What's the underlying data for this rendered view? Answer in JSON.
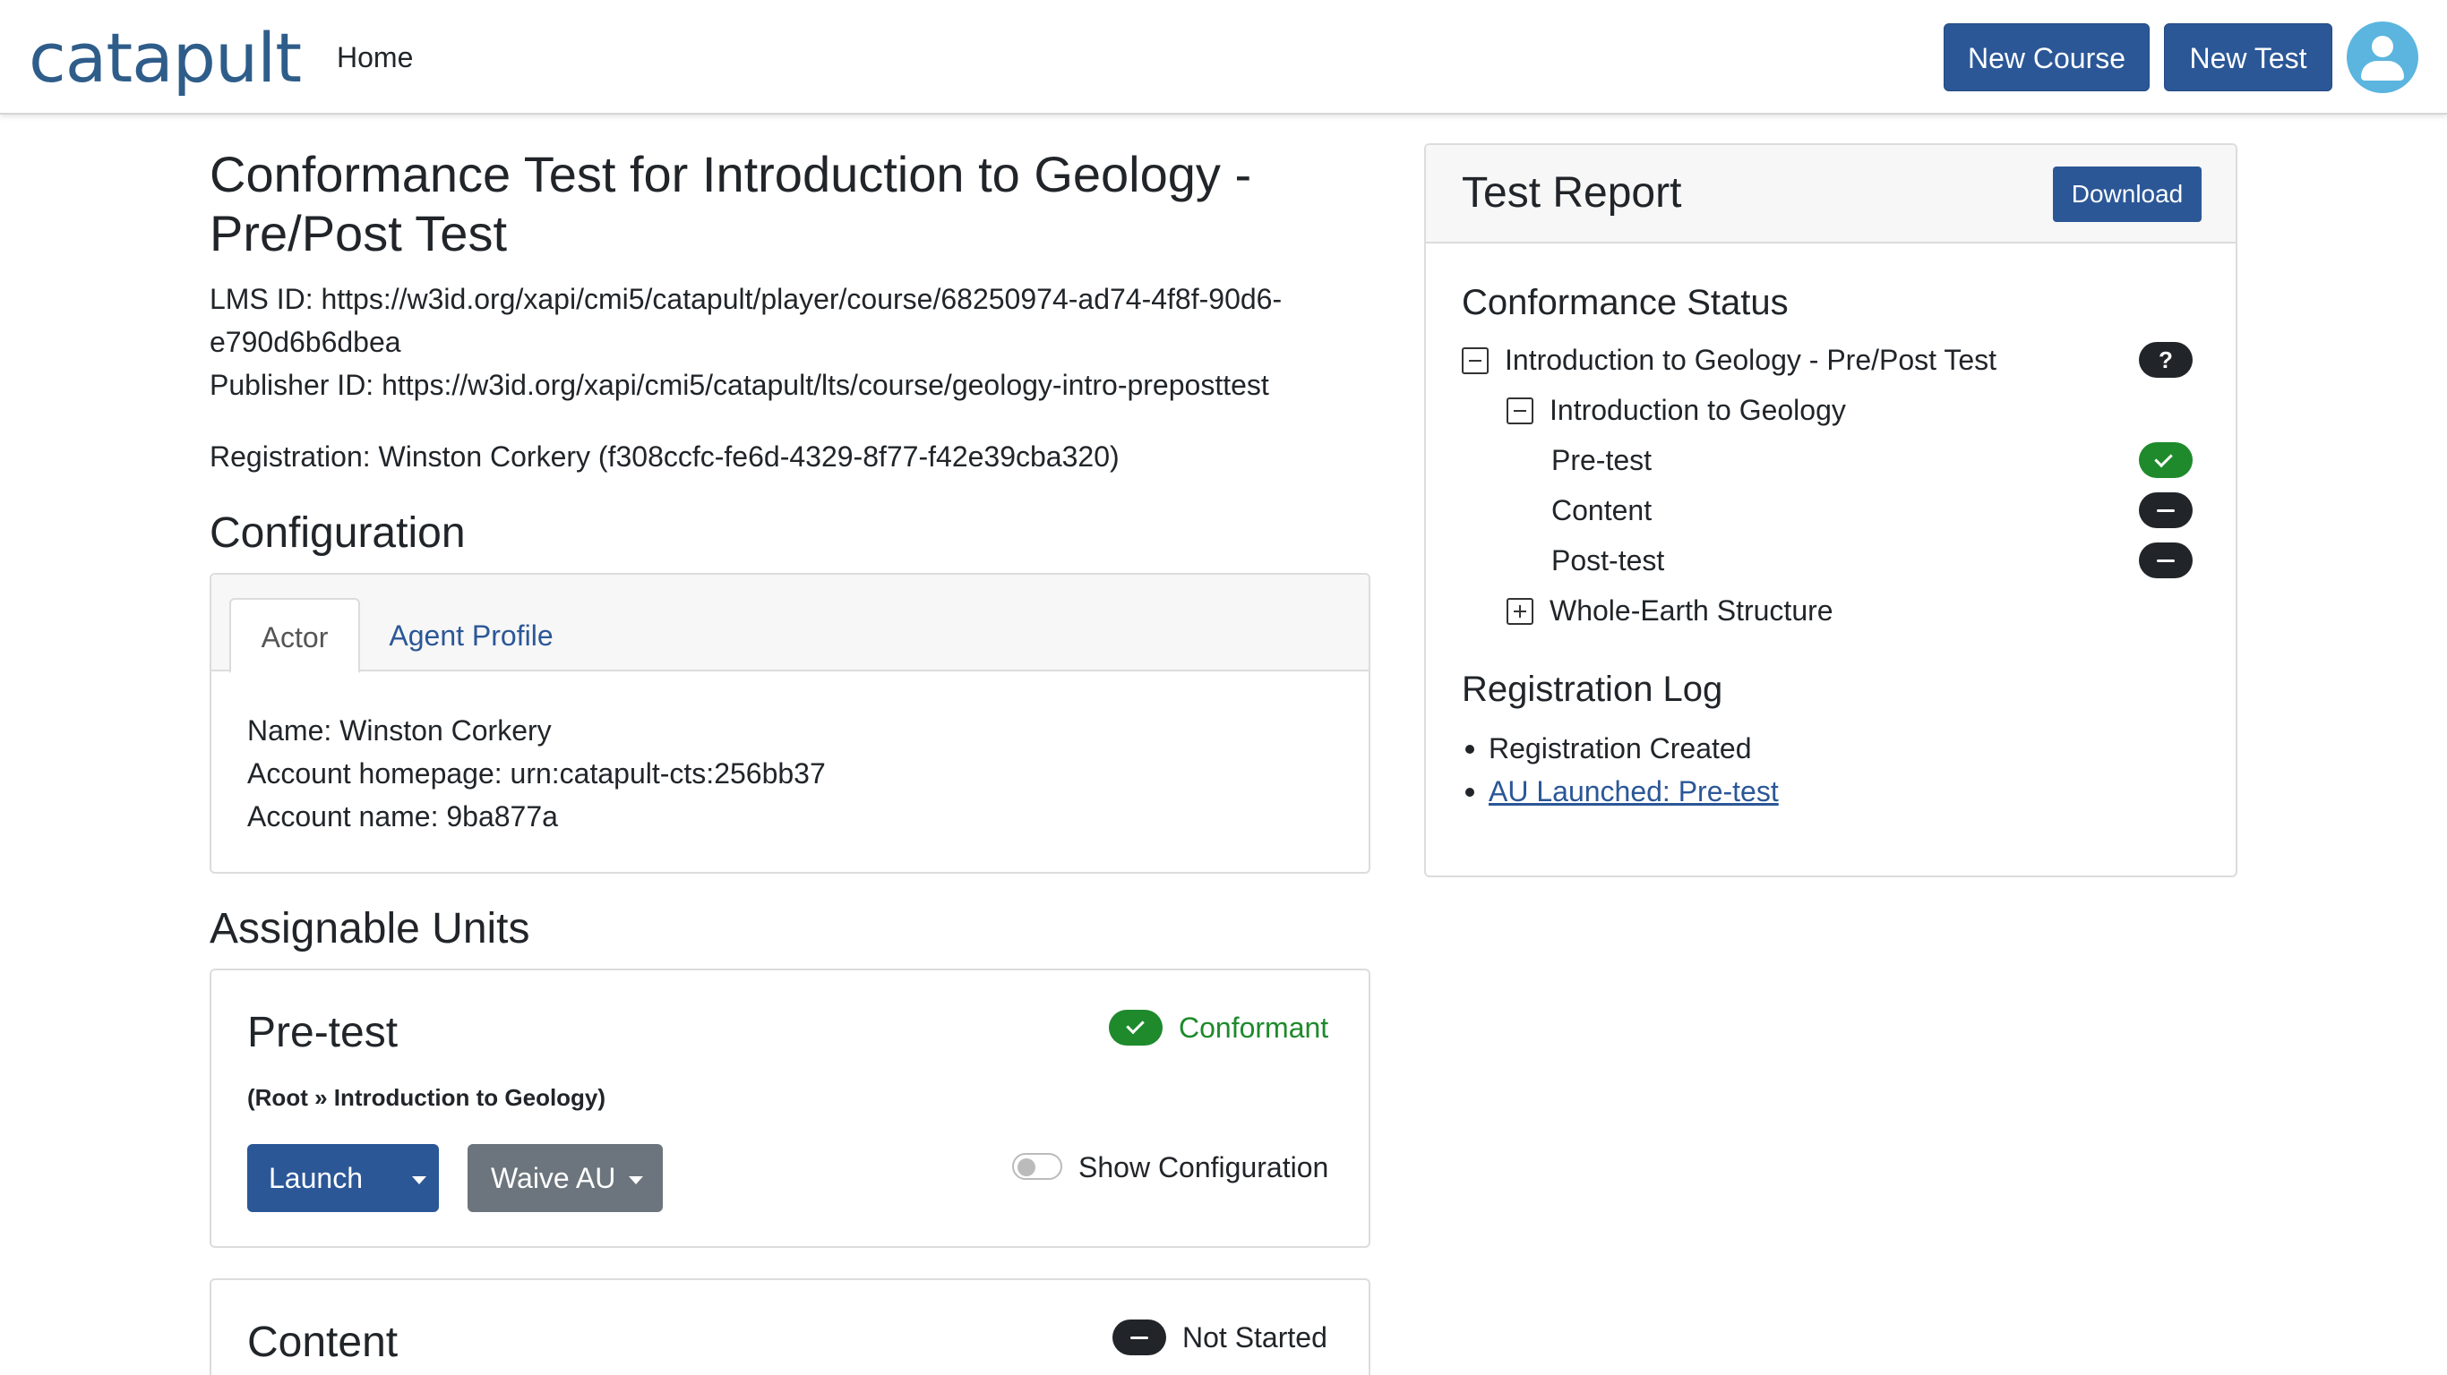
{
  "navbar": {
    "brand": "catapult",
    "home": "Home",
    "new_course": "New Course",
    "new_test": "New Test"
  },
  "page": {
    "title": "Conformance Test for Introduction to Geology - Pre/Post Test",
    "lms_id_line1": "LMS ID: https://w3id.org/xapi/cmi5/catapult/player/course/68250974-ad74-4f8f-90d6-",
    "lms_id_line2": "e790d6b6dbea",
    "publisher_id": "Publisher ID: https://w3id.org/xapi/cmi5/catapult/lts/course/geology-intro-preposttest",
    "registration": "Registration: Winston Corkery (f308ccfc-fe6d-4329-8f77-f42e39cba320)"
  },
  "configuration": {
    "heading": "Configuration",
    "tabs": [
      {
        "label": "Actor",
        "active": true
      },
      {
        "label": "Agent Profile",
        "active": false
      }
    ],
    "actor": {
      "name": "Name: Winston Corkery",
      "homepage": "Account homepage: urn:catapult-cts:256bb37",
      "account_name": "Account name: 9ba877a"
    }
  },
  "assignable_units": {
    "heading": "Assignable Units",
    "items": [
      {
        "title": "Pre-test",
        "path": "(Root » Introduction to Geology)",
        "status": "Conformant",
        "status_color": "#1e8a2c",
        "launch_label": "Launch",
        "waive_label": "Waive AU",
        "show_config_label": "Show Configuration",
        "show_config_on": false
      },
      {
        "title": "Content",
        "status": "Not Started",
        "status_color": "#212529"
      }
    ]
  },
  "test_report": {
    "title": "Test Report",
    "download_label": "Download",
    "conformance_heading": "Conformance Status",
    "tree": [
      {
        "label": "Introduction to Geology - Pre/Post Test",
        "toggle": "minus",
        "badge": "?",
        "badge_type": "unknown"
      },
      {
        "label": "Introduction to Geology",
        "toggle": "minus",
        "badge": "",
        "badge_type": "none"
      },
      {
        "label": "Pre-test",
        "toggle": "none",
        "badge": "check-icon",
        "badge_type": "pass"
      },
      {
        "label": "Content",
        "toggle": "none",
        "badge": "dash-icon",
        "badge_type": "not-started"
      },
      {
        "label": "Post-test",
        "toggle": "none",
        "badge": "dash-icon",
        "badge_type": "not-started"
      },
      {
        "label": "Whole-Earth Structure",
        "toggle": "plus",
        "badge": "",
        "badge_type": "none"
      }
    ],
    "log_heading": "Registration Log",
    "log": [
      {
        "text": "Registration Created",
        "link": false
      },
      {
        "text": "AU Launched: Pre-test",
        "link": true
      }
    ]
  },
  "colors": {
    "primary": "#2b5797",
    "secondary": "#6c757d",
    "success": "#1e8a2c",
    "dark": "#212529",
    "avatar": "#5bb5df"
  }
}
